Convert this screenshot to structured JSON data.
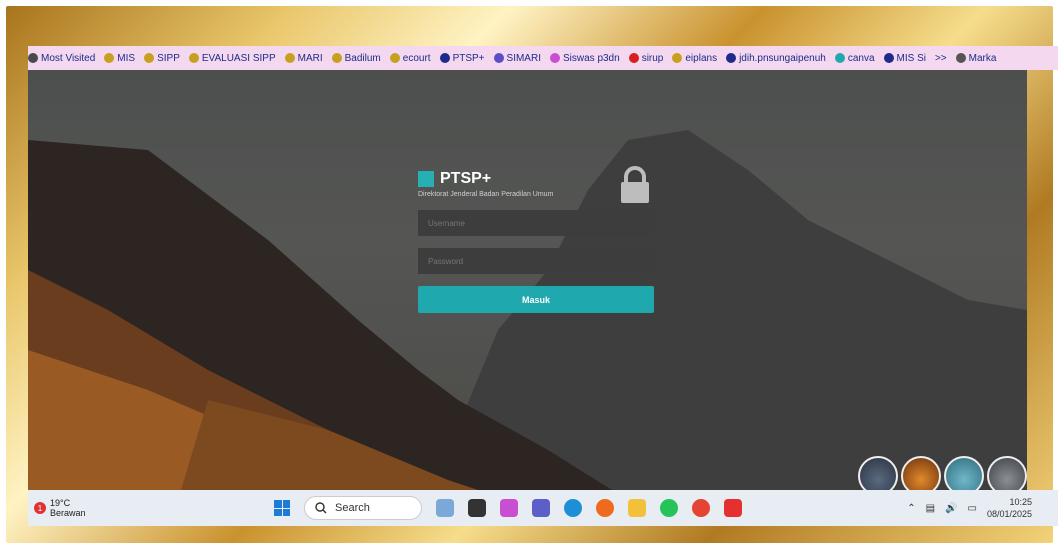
{
  "bookmarks": [
    {
      "label": "Most Visited",
      "icon": "gear-icon"
    },
    {
      "label": "MIS",
      "icon": "gold-circle-icon"
    },
    {
      "label": "SIPP",
      "icon": "gold-circle-icon"
    },
    {
      "label": "EVALUASI SIPP",
      "icon": "gold-circle-icon"
    },
    {
      "label": "MARI",
      "icon": "gold-circle-icon"
    },
    {
      "label": "Badilum",
      "icon": "gold-circle-icon"
    },
    {
      "label": "ecourt",
      "icon": "gold-circle-icon"
    },
    {
      "label": "PTSP+",
      "icon": "globe-icon"
    },
    {
      "label": "SIMARI",
      "icon": "heart-icon"
    },
    {
      "label": "Siswas p3dn",
      "icon": "s-icon"
    },
    {
      "label": "sirup",
      "icon": "arrow-icon"
    },
    {
      "label": "eiplans",
      "icon": "gold-circle-icon"
    },
    {
      "label": "jdih.pnsungaipenuh",
      "icon": "globe-icon"
    },
    {
      "label": "canva",
      "icon": "canva-icon"
    },
    {
      "label": "MIS Si",
      "icon": "globe-icon"
    },
    {
      "label": ">>",
      "icon": ""
    },
    {
      "label": "Marka",
      "icon": "folder-icon"
    }
  ],
  "login": {
    "app_title": "PTSP+",
    "subtitle": "Direktorat Jenderal Badan Peradilan Umum",
    "username_placeholder": "Username",
    "password_placeholder": "Password",
    "submit_label": "Masuk"
  },
  "taskbar": {
    "weather_temp": "19°C",
    "weather_desc": "Berawan",
    "weather_badge": "1",
    "search_label": "Search",
    "time": "10:25",
    "date": "08/01/2025"
  },
  "colors": {
    "accent": "#1fa8ad",
    "bookmark_bar": "#f4d8ef"
  }
}
